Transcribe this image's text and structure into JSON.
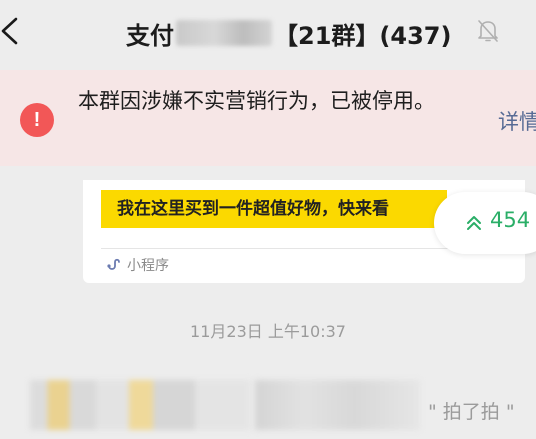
{
  "header": {
    "title_prefix": "支付",
    "title_suffix": "【21群】(437)"
  },
  "banner": {
    "message": "本群因涉嫌不实营销行为，已被停用。",
    "link": "详情"
  },
  "card": {
    "promo_text": "我在这里买到一件超值好物，快来看",
    "footer_label": "小程序"
  },
  "unread": {
    "count": "454"
  },
  "timestamp": "11月23日 上午10:37",
  "system_message": "\" 拍了拍 \""
}
